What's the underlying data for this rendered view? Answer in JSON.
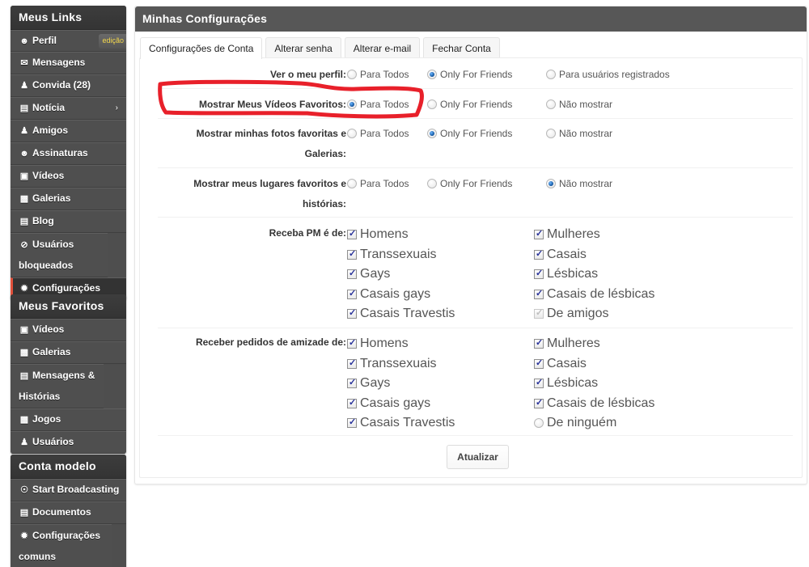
{
  "sidebar": {
    "links": {
      "title": "Meus Links",
      "edit_badge": "edição",
      "items": [
        {
          "label": "Perfil",
          "icon": "user-icon"
        },
        {
          "label": "Mensagens",
          "icon": "envelope-icon"
        },
        {
          "label": "Convida (28)",
          "icon": "invite-users-icon"
        },
        {
          "label": "Notícia",
          "icon": "news-icon"
        },
        {
          "label": "Amigos",
          "icon": "friends-icon"
        },
        {
          "label": "Assinaturas",
          "icon": "subscriptions-icon"
        },
        {
          "label": "Vídeos",
          "icon": "video-camera-icon"
        },
        {
          "label": "Galerias",
          "icon": "camera-icon"
        },
        {
          "label": "Blog",
          "icon": "comment-icon"
        },
        {
          "label": "Usuários bloqueados",
          "icon": "block-icon"
        },
        {
          "label": "Configurações",
          "icon": "gear-icon",
          "active": true
        }
      ]
    },
    "favorites": {
      "title": "Meus Favoritos",
      "items": [
        {
          "label": "Vídeos",
          "icon": "video-camera-icon"
        },
        {
          "label": "Galerias",
          "icon": "camera-icon"
        },
        {
          "label": "Mensagens & Histórias",
          "icon": "comment-icon"
        },
        {
          "label": "Jogos",
          "icon": "gamepad-icon"
        },
        {
          "label": "Usuários",
          "icon": "users-icon"
        }
      ]
    },
    "model_account": {
      "title": "Conta modelo",
      "items": [
        {
          "label": "Start Broadcasting",
          "icon": "broadcast-icon"
        },
        {
          "label": "Documentos",
          "icon": "document-icon"
        },
        {
          "label": "Configurações comuns",
          "icon": "gear-icon"
        }
      ]
    }
  },
  "main": {
    "title": "Minhas Configurações",
    "tabs": [
      {
        "label": "Configurações de Conta",
        "active": true
      },
      {
        "label": "Alterar senha"
      },
      {
        "label": "Alterar e-mail"
      },
      {
        "label": "Fechar Conta"
      }
    ],
    "privacy": [
      {
        "label": "Ver o meu perfil:",
        "options": [
          "Para Todos",
          "Only For Friends",
          "Para usuários registrados"
        ],
        "selected": "Only For Friends"
      },
      {
        "label": "Mostrar Meus Vídeos Favoritos:",
        "options": [
          "Para Todos",
          "Only For Friends",
          "Não mostrar"
        ],
        "selected": "Para Todos"
      },
      {
        "label_line1": "Mostrar minhas fotos favoritas e",
        "label_line2": "Galerias:",
        "options": [
          "Para Todos",
          "Only For Friends",
          "Não mostrar"
        ],
        "selected": "Only For Friends"
      },
      {
        "label_line1": "Mostrar meus lugares favoritos e",
        "label_line2": "histórias:",
        "options": [
          "Para Todos",
          "Only For Friends",
          "Não mostrar"
        ],
        "selected": "Não mostrar"
      }
    ],
    "pm": {
      "label": "Receba PM é de:",
      "left": [
        {
          "label": "Homens",
          "checked": true
        },
        {
          "label": "Transsexuais",
          "checked": true
        },
        {
          "label": "Gays",
          "checked": true
        },
        {
          "label": "Casais gays",
          "checked": true
        },
        {
          "label": "Casais Travestis",
          "checked": true
        }
      ],
      "right": [
        {
          "label": "Mulheres",
          "checked": true
        },
        {
          "label": "Casais",
          "checked": true
        },
        {
          "label": "Lésbicas",
          "checked": true
        },
        {
          "label": "Casais de lésbicas",
          "checked": true
        },
        {
          "label": "De amigos",
          "checked": true,
          "disabled": true
        }
      ]
    },
    "friend_requests": {
      "label": "Receber pedidos de amizade de:",
      "left": [
        {
          "label": "Homens",
          "checked": true
        },
        {
          "label": "Transsexuais",
          "checked": true
        },
        {
          "label": "Gays",
          "checked": true
        },
        {
          "label": "Casais gays",
          "checked": true
        },
        {
          "label": "Casais Travestis",
          "checked": true
        }
      ],
      "right": [
        {
          "label": "Mulheres",
          "checked": true
        },
        {
          "label": "Casais",
          "checked": true
        },
        {
          "label": "Lésbicas",
          "checked": true
        },
        {
          "label": "Casais de lésbicas",
          "checked": true
        },
        {
          "label": "De ninguém",
          "type": "radio",
          "checked": false
        }
      ]
    },
    "submit_label": "Atualizar"
  },
  "annotation": {
    "color": "#e8202a",
    "target": "Mostrar Meus Vídeos Favoritos"
  }
}
